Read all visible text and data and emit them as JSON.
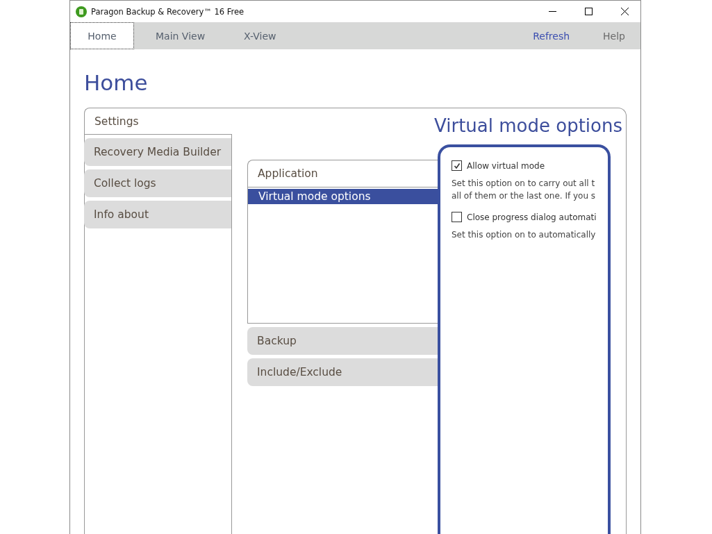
{
  "window": {
    "title": "Paragon Backup & Recovery™ 16 Free"
  },
  "tabs": [
    {
      "label": "Home",
      "selected": true
    },
    {
      "label": "Main View",
      "selected": false
    },
    {
      "label": "X-View",
      "selected": false
    }
  ],
  "toolbar_links": [
    {
      "label": "Refresh",
      "kind": "link"
    },
    {
      "label": "Help",
      "kind": "menu"
    }
  ],
  "page_title": "Home",
  "sidebar": {
    "items": [
      {
        "label": "Settings",
        "selected": true
      },
      {
        "label": "Recovery Media Builder",
        "selected": false
      },
      {
        "label": "Collect logs",
        "selected": false
      },
      {
        "label": "Info about",
        "selected": false
      }
    ]
  },
  "section_title": "Virtual mode options",
  "categories": [
    {
      "label": "Application",
      "expanded": true,
      "items": [
        {
          "label": "Virtual mode options",
          "selected": true
        }
      ]
    },
    {
      "label": "Backup",
      "expanded": false
    },
    {
      "label": "Include/Exclude",
      "expanded": false
    }
  ],
  "options": [
    {
      "label": "Allow virtual mode",
      "checked": true,
      "description": [
        "Set this option on to carry out all t",
        "all of them or the last one. If you s"
      ]
    },
    {
      "label": "Close progress dialog automati",
      "checked": false,
      "description": [
        "Set this option on to automatically"
      ]
    }
  ]
}
